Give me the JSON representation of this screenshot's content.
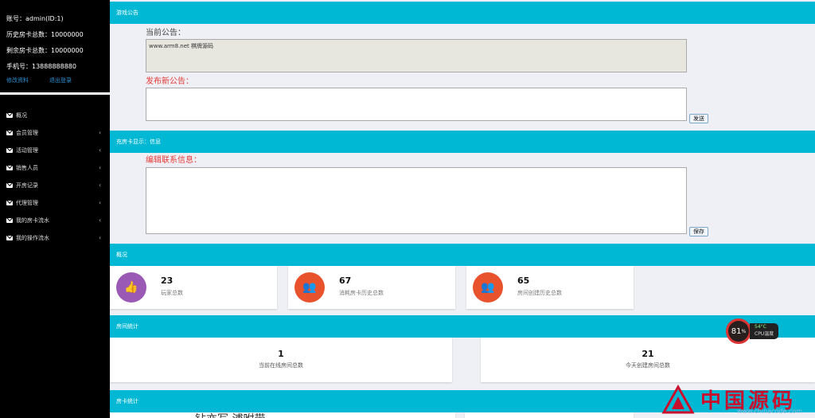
{
  "user": {
    "account": "账号：admin(ID:1)",
    "history_cards": "历史房卡总数：10000000",
    "remaining_cards": "剩余房卡总数：10000000",
    "phone": "手机号：13888888880",
    "edit_profile": "修改资料",
    "logout": "退出登录"
  },
  "menu": [
    {
      "label": "概况",
      "has_arrow": false
    },
    {
      "label": "会员管理",
      "has_arrow": true
    },
    {
      "label": "活动管理",
      "has_arrow": true
    },
    {
      "label": "销售人员",
      "has_arrow": true
    },
    {
      "label": "开房记录",
      "has_arrow": true
    },
    {
      "label": "代理管理",
      "has_arrow": true
    },
    {
      "label": "我的房卡流水",
      "has_arrow": true
    },
    {
      "label": "我的操作流水",
      "has_arrow": true
    }
  ],
  "menu_arrow": "‹",
  "announcement": {
    "header": "游戏公告",
    "current_label": "当前公告：",
    "current_value": "www.arm8.net 棋牌源码",
    "new_label": "发布新公告：",
    "new_value": "",
    "send_button": "发送"
  },
  "recharge": {
    "header": "充房卡显示：信息",
    "edit_label": "编辑联系信息：",
    "edit_value": "",
    "save_button": "保存"
  },
  "overview": {
    "header": "概况",
    "stats": [
      {
        "value": "23",
        "label": "玩家总数",
        "color": "#9b59b6",
        "icon": "thumbs-up-icon"
      },
      {
        "value": "67",
        "label": "消耗房卡历史总数",
        "color": "#e8532d",
        "icon": "users-icon"
      },
      {
        "value": "65",
        "label": "房间创建历史总数",
        "color": "#e8532d",
        "icon": "users-icon"
      }
    ]
  },
  "room_stats": {
    "header": "房间统计",
    "online_value": "1",
    "online_label": "当前在线房间总数",
    "today_value": "21",
    "today_label": "今天创建房间总数"
  },
  "card_stats": {
    "header": "房卡统计",
    "partial_text": "钻亦写  浦咐带"
  },
  "cpu_widget": {
    "percent": "81",
    "percent_sign": "%",
    "temp": "54°C",
    "label": "CPU温度"
  },
  "watermark": {
    "text": "中国源码",
    "url": "www.chinacode.com"
  }
}
